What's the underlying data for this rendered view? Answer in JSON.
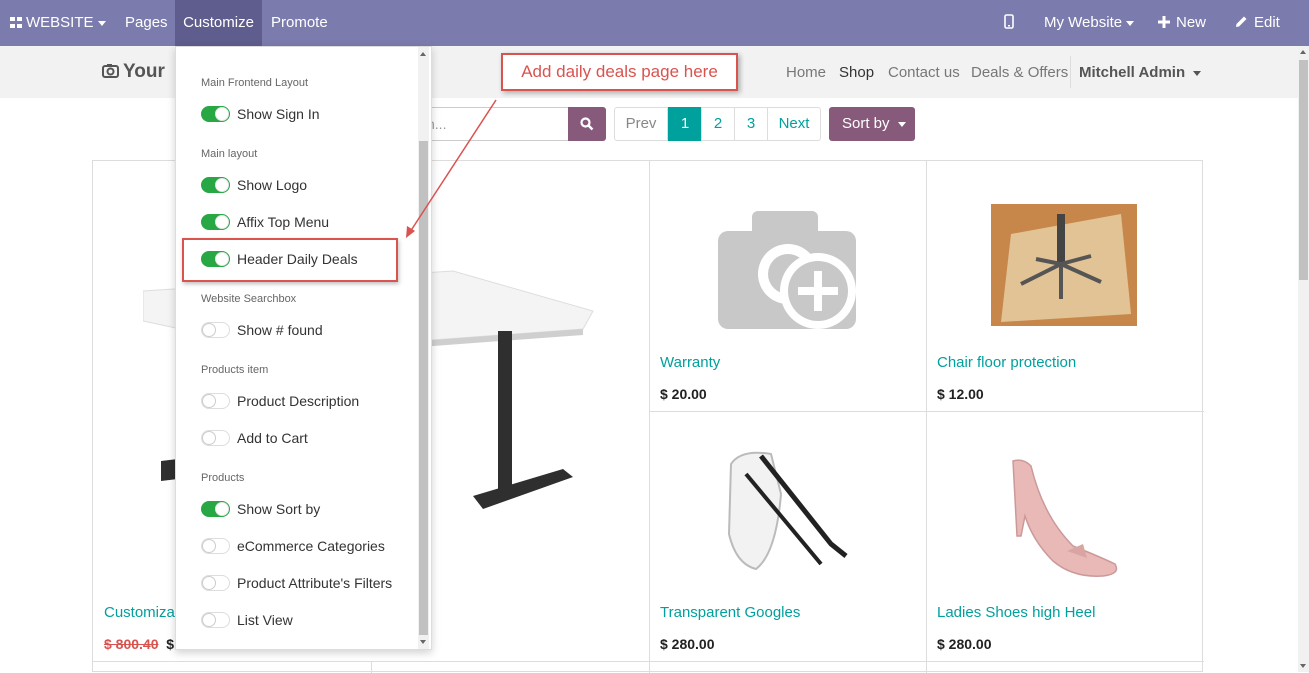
{
  "topbar": {
    "website_label": "WEBSITE",
    "pages_label": "Pages",
    "customize_label": "Customize",
    "promote_label": "Promote",
    "my_website_label": "My Website",
    "new_label": "New",
    "edit_label": "Edit"
  },
  "header": {
    "brand": "Your",
    "nav": [
      "Home",
      "Shop",
      "Contact us",
      "Deals & Offers"
    ],
    "user": "Mitchell Admin"
  },
  "search": {
    "placeholder": "n..."
  },
  "pager": {
    "prev": "Prev",
    "pages": [
      "1",
      "2",
      "3"
    ],
    "next": "Next",
    "active": "1"
  },
  "sort": {
    "label": "Sort by"
  },
  "customize_panel": {
    "sections": [
      {
        "title": "Main Frontend Layout",
        "options": [
          {
            "label": "Show Sign In",
            "on": true
          }
        ]
      },
      {
        "title": "Main layout",
        "options": [
          {
            "label": "Show Logo",
            "on": true
          },
          {
            "label": "Affix Top Menu",
            "on": true
          },
          {
            "label": "Header Daily Deals",
            "on": true
          }
        ]
      },
      {
        "title": "Website Searchbox",
        "options": [
          {
            "label": "Show # found",
            "on": false
          }
        ]
      },
      {
        "title": "Products item",
        "options": [
          {
            "label": "Product Description",
            "on": false
          },
          {
            "label": "Add to Cart",
            "on": false
          }
        ]
      },
      {
        "title": "Products",
        "options": [
          {
            "label": "Show Sort by",
            "on": true
          },
          {
            "label": "eCommerce Categories",
            "on": false
          },
          {
            "label": "Product Attribute's Filters",
            "on": false
          },
          {
            "label": "List View",
            "on": false
          }
        ]
      }
    ]
  },
  "annotation": {
    "text": "Add daily deals page here"
  },
  "products": [
    {
      "name": "Customizab",
      "old_price": "$ 800.40",
      "price": "$"
    },
    {
      "name": "Warranty",
      "price": "$ 20.00"
    },
    {
      "name": "Chair floor protection",
      "price": "$ 12.00"
    },
    {
      "name": "Transparent Googles",
      "price": "$ 280.00"
    },
    {
      "name": "Ladies Shoes high Heel",
      "price": "$ 280.00"
    }
  ],
  "colors": {
    "topbar": "#7C7BAD",
    "accent": "#875A7B",
    "link": "#00A09D",
    "annotation": "#d9534f",
    "toggle_on": "#28a745"
  }
}
